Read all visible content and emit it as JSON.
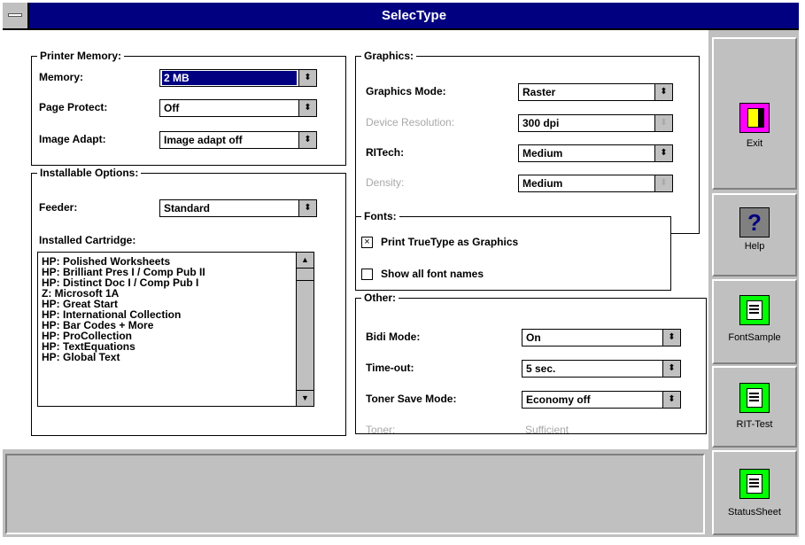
{
  "window": {
    "title": "SelecType"
  },
  "printer_memory": {
    "group_label": "Printer Memory:",
    "memory": {
      "label": "Memory:",
      "value": "2 MB"
    },
    "page_protect": {
      "label": "Page Protect:",
      "value": "Off"
    },
    "image_adapt": {
      "label": "Image Adapt:",
      "value": "Image adapt off"
    }
  },
  "installable_options": {
    "group_label": "Installable Options:",
    "feeder": {
      "label": "Feeder:",
      "value": "Standard"
    },
    "cartridge_label": "Installed Cartridge:",
    "cartridges": [
      "HP: Polished Worksheets",
      "HP: Brilliant Pres I / Comp Pub II",
      "HP: Distinct Doc I / Comp Pub I",
      "Z: Microsoft 1A",
      "HP: Great Start",
      "HP: International Collection",
      "HP: Bar Codes + More",
      "HP: ProCollection",
      "HP: TextEquations",
      "HP: Global Text"
    ]
  },
  "graphics": {
    "group_label": "Graphics:",
    "graphics_mode": {
      "label": "Graphics Mode:",
      "value": "Raster"
    },
    "device_resolution": {
      "label": "Device Resolution:",
      "value": "300 dpi"
    },
    "ritech": {
      "label": "RITech:",
      "value": "Medium"
    },
    "density": {
      "label": "Density:",
      "value": "Medium"
    }
  },
  "fonts": {
    "group_label": "Fonts:",
    "print_truetype": {
      "label": "Print TrueType as Graphics",
      "checked": true,
      "mark": "×"
    },
    "show_all": {
      "label": "Show all font names",
      "checked": false,
      "mark": ""
    }
  },
  "other": {
    "group_label": "Other:",
    "bidi_mode": {
      "label": "Bidi Mode:",
      "value": "On"
    },
    "time_out": {
      "label": "Time-out:",
      "value": "5 sec."
    },
    "toner_save": {
      "label": "Toner Save Mode:",
      "value": "Economy off"
    },
    "toner": {
      "label": "Toner:",
      "value": "Sufficient"
    }
  },
  "sidebar": {
    "exit": "Exit",
    "help": "Help",
    "font_sample": "FontSample",
    "rit_test": "RIT-Test",
    "status_sheet": "StatusSheet"
  },
  "glyphs": {
    "combo_arrow": "⬍",
    "scroll_up": "▲",
    "scroll_down": "▼",
    "help_mark": "?"
  },
  "colors": {
    "titlebar": "#000080",
    "face": "#c0c0c0",
    "selection": "#000080",
    "icon_green": "#00ff00",
    "icon_exit": "#ff00ff"
  }
}
